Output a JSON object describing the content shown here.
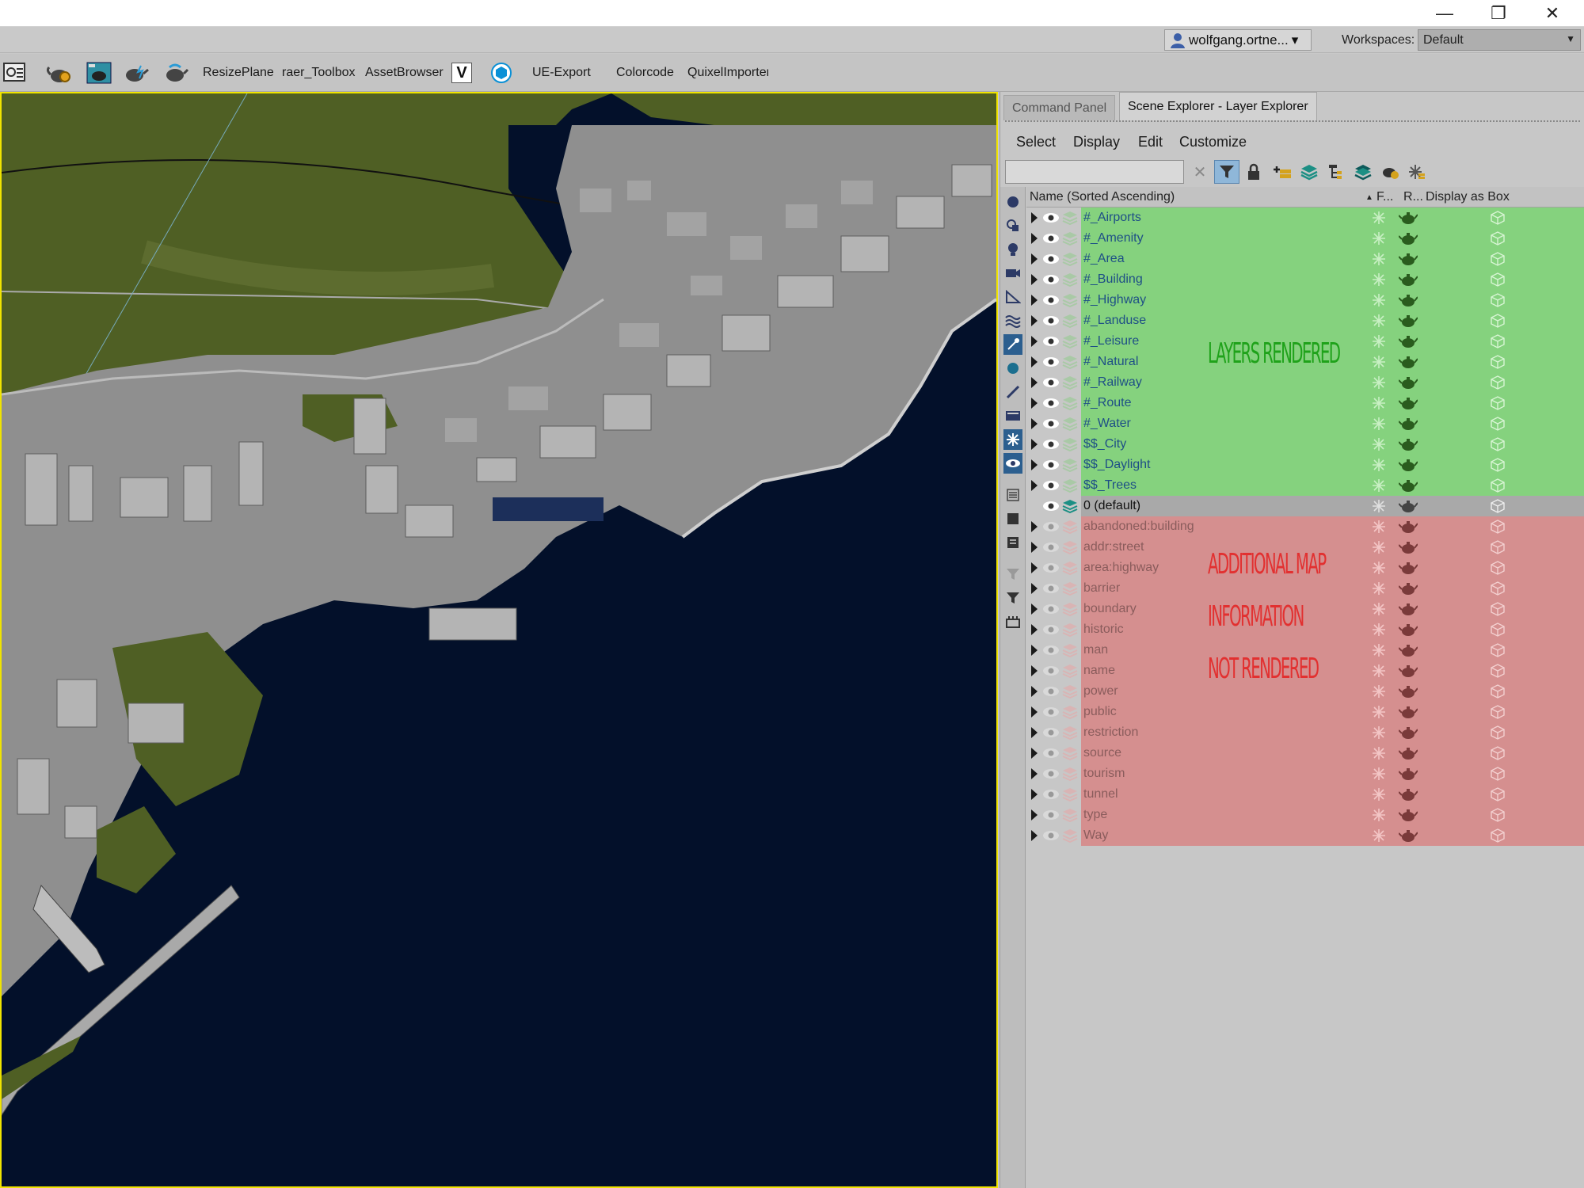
{
  "window": {
    "minimize_glyph": "—",
    "restore_glyph": "❐",
    "close_glyph": "✕"
  },
  "userbar": {
    "user_name": "wolfgang.ortne...",
    "user_dropdown_glyph": "▾",
    "workspaces_label": "Workspaces:",
    "workspace_value": "Default",
    "workspace_dropdown_glyph": "▼"
  },
  "toolbar": {
    "icons": [
      "macro-recorder-icon",
      "render-setup-teapot-icon",
      "rendered-frame-window-icon",
      "render-teapot-icon",
      "render-production-teapot-icon"
    ],
    "labels": [
      "ResizePlane",
      "raer_Toolbox",
      "AssetBrowser",
      "UE-Export",
      "Colorcode",
      "QuixelImporter"
    ],
    "v_icon_glyph": "V"
  },
  "panel": {
    "tabs": [
      "Command Panel",
      "Scene Explorer - Layer Explorer"
    ],
    "menu": [
      "Select",
      "Display",
      "Edit",
      "Customize"
    ],
    "search_placeholder": "",
    "clear_glyph": "✕",
    "columns": {
      "name": "Name (Sorted Ascending)",
      "sort_glyph": "▲",
      "frozen": "F...",
      "renderable": "R...",
      "display_box": "Display as Box"
    },
    "green_layers": [
      "#_Airports",
      "#_Amenity",
      "#_Area",
      "#_Building",
      "#_Highway",
      "#_Landuse",
      "#_Leisure",
      "#_Natural",
      "#_Railway",
      "#_Route",
      "#_Water",
      "$$_City",
      "$$_Daylight",
      "$$_Trees"
    ],
    "default_layer": "0 (default)",
    "red_layers": [
      "abandoned:building",
      "addr:street",
      "area:highway",
      "barrier",
      "boundary",
      "historic",
      "man",
      "name",
      "power",
      "public",
      "restriction",
      "source",
      "tourism",
      "tunnel",
      "type",
      "Way"
    ],
    "annotations": {
      "green_text": "LAYERS RENDERED",
      "red_line1": "ADDITIONAL MAP",
      "red_line2": "INFORMATION",
      "red_line3": "NOT RENDERED",
      "green_color": "#1fa21a",
      "red_color": "#e23030"
    }
  },
  "colors": {
    "viewport_border": "#f0e400",
    "water": "#03102a",
    "terrain": "#4f5f24",
    "buildings": "#9a9a9a",
    "rendered_row": "#85d27e",
    "not_rendered_row": "#d58f8f"
  }
}
